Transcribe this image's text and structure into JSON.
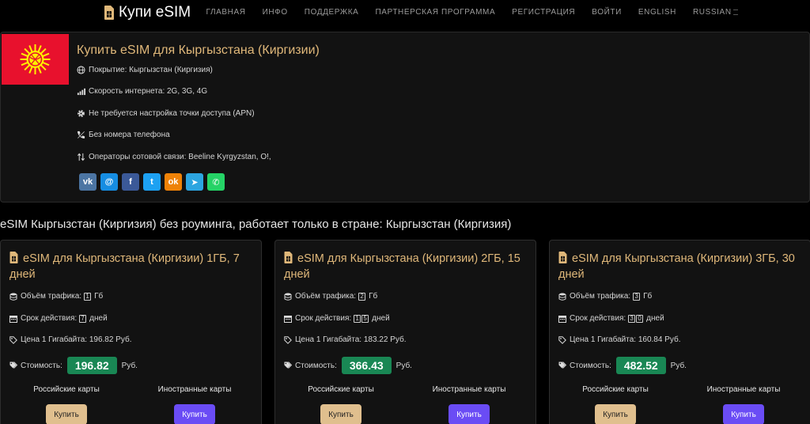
{
  "brand": {
    "title": "Купи eSIM"
  },
  "nav": [
    "ГЛАВНАЯ",
    "ИНФО",
    "ПОДДЕРЖКА",
    "ПАРТНЕРСКАЯ ПРОГРАММА",
    "РЕГИСТРАЦИЯ",
    "ВОЙТИ",
    "ENGLISH",
    "RUSSIAN"
  ],
  "country": {
    "title": "Купить eSIM для Кыргызстана (Киргизии)",
    "coverage": "Покрытие: Кыргызстан (Киргизия)",
    "speed": "Скорость интернета: 2G, 3G, 4G",
    "apn": "Не требуется настройка точки доступа (APN)",
    "phone": "Без номера телефона",
    "operators": "Операторы сотовой связи: Beeline Kyrgyzstan, O!,"
  },
  "social": [
    {
      "icon": "vk-icon",
      "glyph": "vk",
      "color": "#4c75a3"
    },
    {
      "icon": "moimir-icon",
      "glyph": "@",
      "color": "#168de2"
    },
    {
      "icon": "facebook-icon",
      "glyph": "f",
      "color": "#3b5998"
    },
    {
      "icon": "twitter-icon",
      "glyph": "t",
      "color": "#1da1f2"
    },
    {
      "icon": "odnoklassniki-icon",
      "glyph": "ok",
      "color": "#ee8208"
    },
    {
      "icon": "telegram-icon",
      "glyph": "➤",
      "color": "#2ca5e0"
    },
    {
      "icon": "whatsapp-icon",
      "glyph": "✆",
      "color": "#25d366"
    }
  ],
  "section_heading": "eSIM Кыргызстан (Киргизия) без роуминга, работает только в стране: Кыргызстан (Киргизия)",
  "plans": [
    {
      "title": "eSIM для Кыргызстана (Киргизии) 1ГБ, 7 дней",
      "traffic_label": "Объём трафика:",
      "traffic_digits": [
        "1"
      ],
      "traffic_unit": "Гб",
      "validity_label": "Срок действия:",
      "validity_digits": [
        "7"
      ],
      "validity_unit": "дней",
      "per_gb": "Цена 1 Гигабайта: 196.82 Руб.",
      "cost_label": "Стоимость:",
      "price": "196.82",
      "currency": "Руб.",
      "ru_cards": "Российские карты",
      "foreign_cards": "Иностранные карты",
      "buy": "Купить"
    },
    {
      "title": "eSIM для Кыргызстана (Киргизии) 2ГБ, 15 дней",
      "traffic_label": "Объём трафика:",
      "traffic_digits": [
        "2"
      ],
      "traffic_unit": "Гб",
      "validity_label": "Срок действия:",
      "validity_digits": [
        "1",
        "5"
      ],
      "validity_unit": "дней",
      "per_gb": "Цена 1 Гигабайта: 183.22 Руб.",
      "cost_label": "Стоимость:",
      "price": "366.43",
      "currency": "Руб.",
      "ru_cards": "Российские карты",
      "foreign_cards": "Иностранные карты",
      "buy": "Купить"
    },
    {
      "title": "eSIM для Кыргызстана (Киргизии) 3ГБ, 30 дней",
      "traffic_label": "Объём трафика:",
      "traffic_digits": [
        "3"
      ],
      "traffic_unit": "Гб",
      "validity_label": "Срок действия:",
      "validity_digits": [
        "3",
        "0"
      ],
      "validity_unit": "дней",
      "per_gb": "Цена 1 Гигабайта: 160.84 Руб.",
      "cost_label": "Стоимость:",
      "price": "482.52",
      "currency": "Руб.",
      "ru_cards": "Российские карты",
      "foreign_cards": "Иностранные карты",
      "buy": "Купить"
    }
  ],
  "colors": {
    "accent_gold": "#e0b87a",
    "price_green": "#198754",
    "buy_ru": "#e0bf8e",
    "buy_foreign": "#6a4cf5",
    "flag_red": "#e8112d",
    "flag_sun": "#ffef00"
  }
}
